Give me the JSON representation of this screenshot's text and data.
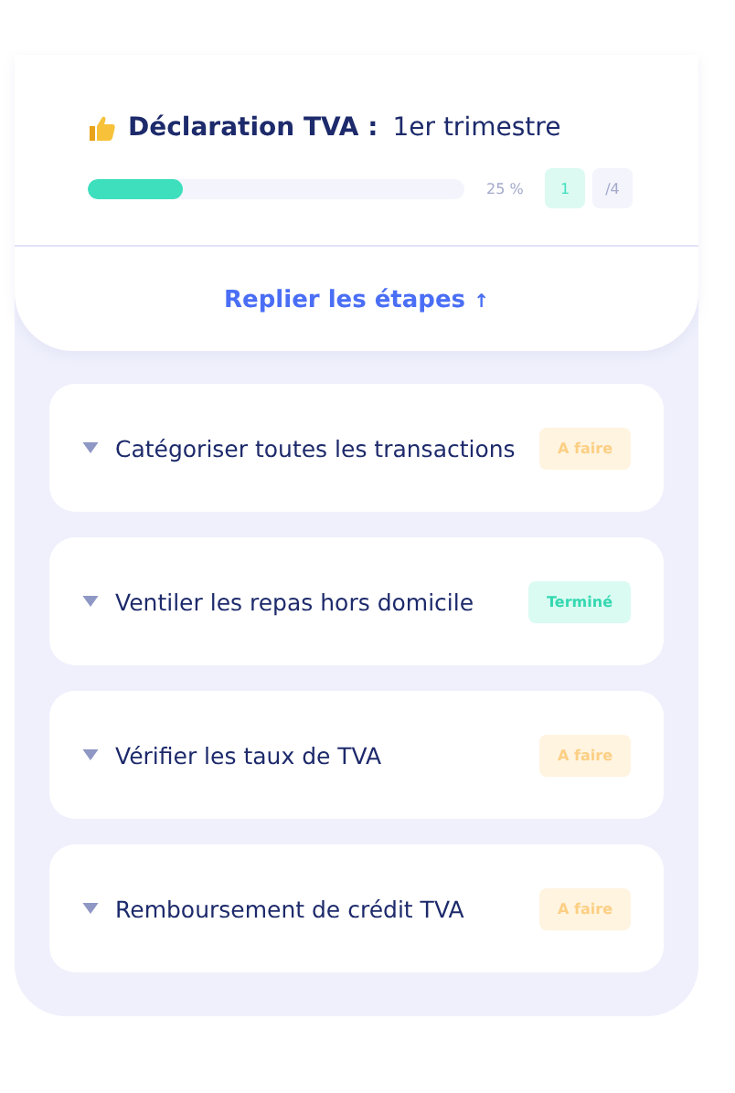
{
  "header": {
    "title": "Déclaration TVA :",
    "subtitle": "1er trimestre",
    "progress": {
      "level": 0.25,
      "reading": "25 %",
      "done": "1",
      "total": "/4"
    }
  },
  "toggle": {
    "label": "Replier les étapes",
    "arrow": "↑"
  },
  "steps": [
    {
      "label": "Catégoriser toutes les transactions",
      "status": "A faire",
      "kind": "todo"
    },
    {
      "label": "Ventiler les repas hors domicile",
      "status": "Terminé",
      "kind": "done"
    },
    {
      "label": "Vérifier les taux de TVA",
      "status": "A faire",
      "kind": "todo"
    },
    {
      "label": "Remboursement de crédit TVA",
      "status": "A faire",
      "kind": "todo"
    }
  ]
}
